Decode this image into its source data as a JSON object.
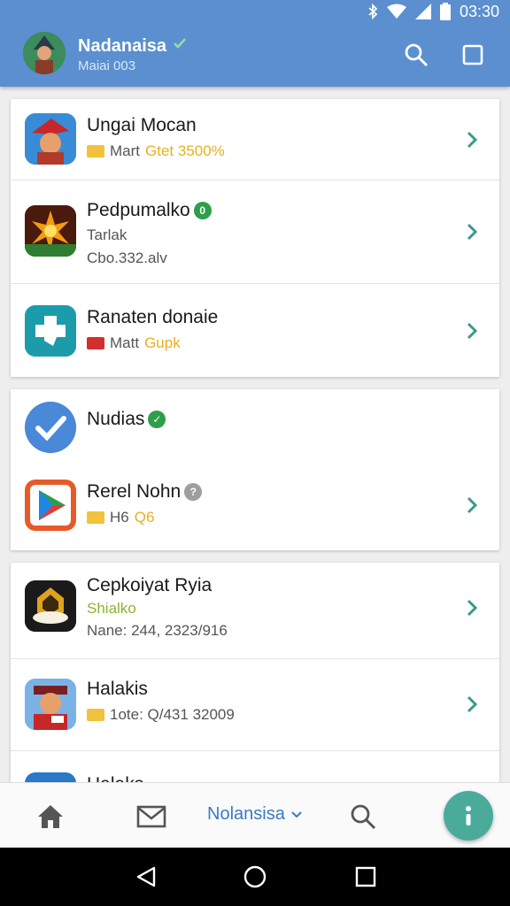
{
  "status": {
    "time": "03:30"
  },
  "header": {
    "name": "Nadanaisa",
    "subtitle": "Maiai 003"
  },
  "cards": [
    {
      "items": [
        {
          "title": "Ungai Mocan",
          "tag_text": "Mart",
          "accent_text": "Gtet 3500%"
        },
        {
          "title": "Pedpumalko",
          "line1": "Tarlak",
          "line2": "Cbo.332.alv"
        },
        {
          "title": "Ranaten donaie",
          "tag_text": "Matt",
          "accent_text": "Gupk"
        }
      ]
    },
    {
      "items": [
        {
          "title": "Nudias"
        },
        {
          "title": "Rerel Nohn",
          "tag_text": "H6",
          "accent_text": "Q6"
        }
      ]
    },
    {
      "items": [
        {
          "title": "Cepkoiyat Ryia",
          "line1": "Shialko",
          "line2": "Nane: 244, 2323/916"
        },
        {
          "title": "Halakis",
          "tag_text": "1ote: Q/431 32009"
        },
        {
          "title": "Halaks"
        }
      ]
    }
  ],
  "bottom_nav": {
    "label": "Nolansisa"
  },
  "colors": {
    "appbar": "#5b8fd0",
    "accent": "#e7b022",
    "fab": "#4aab9b",
    "chevron": "#3a9a8c"
  }
}
